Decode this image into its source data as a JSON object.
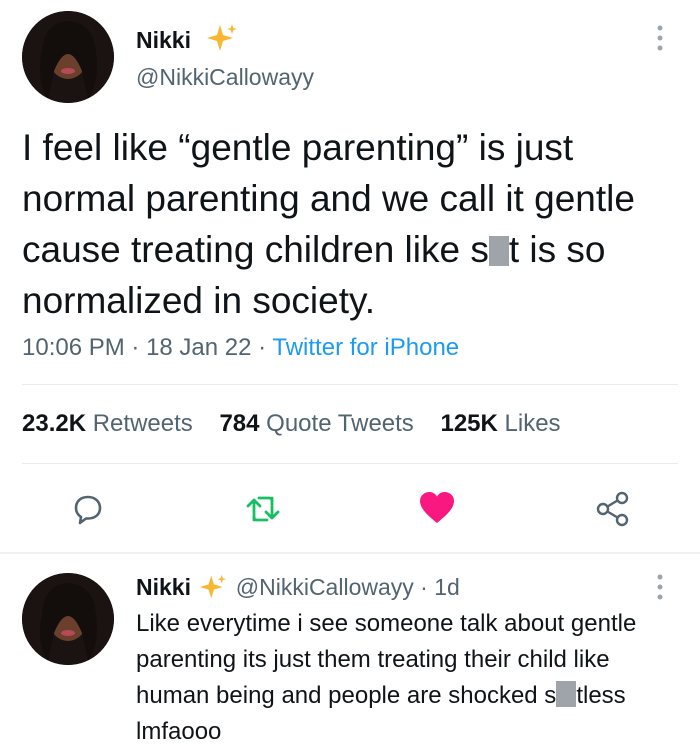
{
  "tweet": {
    "author_name": "Nikki",
    "author_handle": "@NikkiCallowayy",
    "text_part1": "I feel like “gentle parenting” is just normal parenting and we call it gentle cause treating children like s",
    "text_part2": "t is so normalized in society.",
    "time": "10:06 PM",
    "date": "18 Jan 22",
    "source": "Twitter for iPhone",
    "separator": " · "
  },
  "stats": {
    "retweets_count": "23.2K",
    "retweets_label": "Retweets",
    "quotes_count": "784",
    "quotes_label": "Quote Tweets",
    "likes_count": "125K",
    "likes_label": "Likes"
  },
  "actions": {
    "reply_icon": "reply-icon",
    "retweet_icon": "retweet-icon",
    "like_icon": "heart-filled-icon",
    "share_icon": "share-icon",
    "retweet_color": "#17bf63",
    "like_color": "#f91880"
  },
  "reply": {
    "author_name": "Nikki",
    "author_handle": "@NikkiCallowayy",
    "age": "1d",
    "separator": " · ",
    "text_part1": "Like everytime i see someone talk about gentle parenting its just them treating their child like human being and people are shocked s",
    "text_part2": "tless lmfaooo"
  },
  "colors": {
    "sparkle": "#f7b731",
    "link": "#1d9bf0",
    "muted": "#536471"
  }
}
